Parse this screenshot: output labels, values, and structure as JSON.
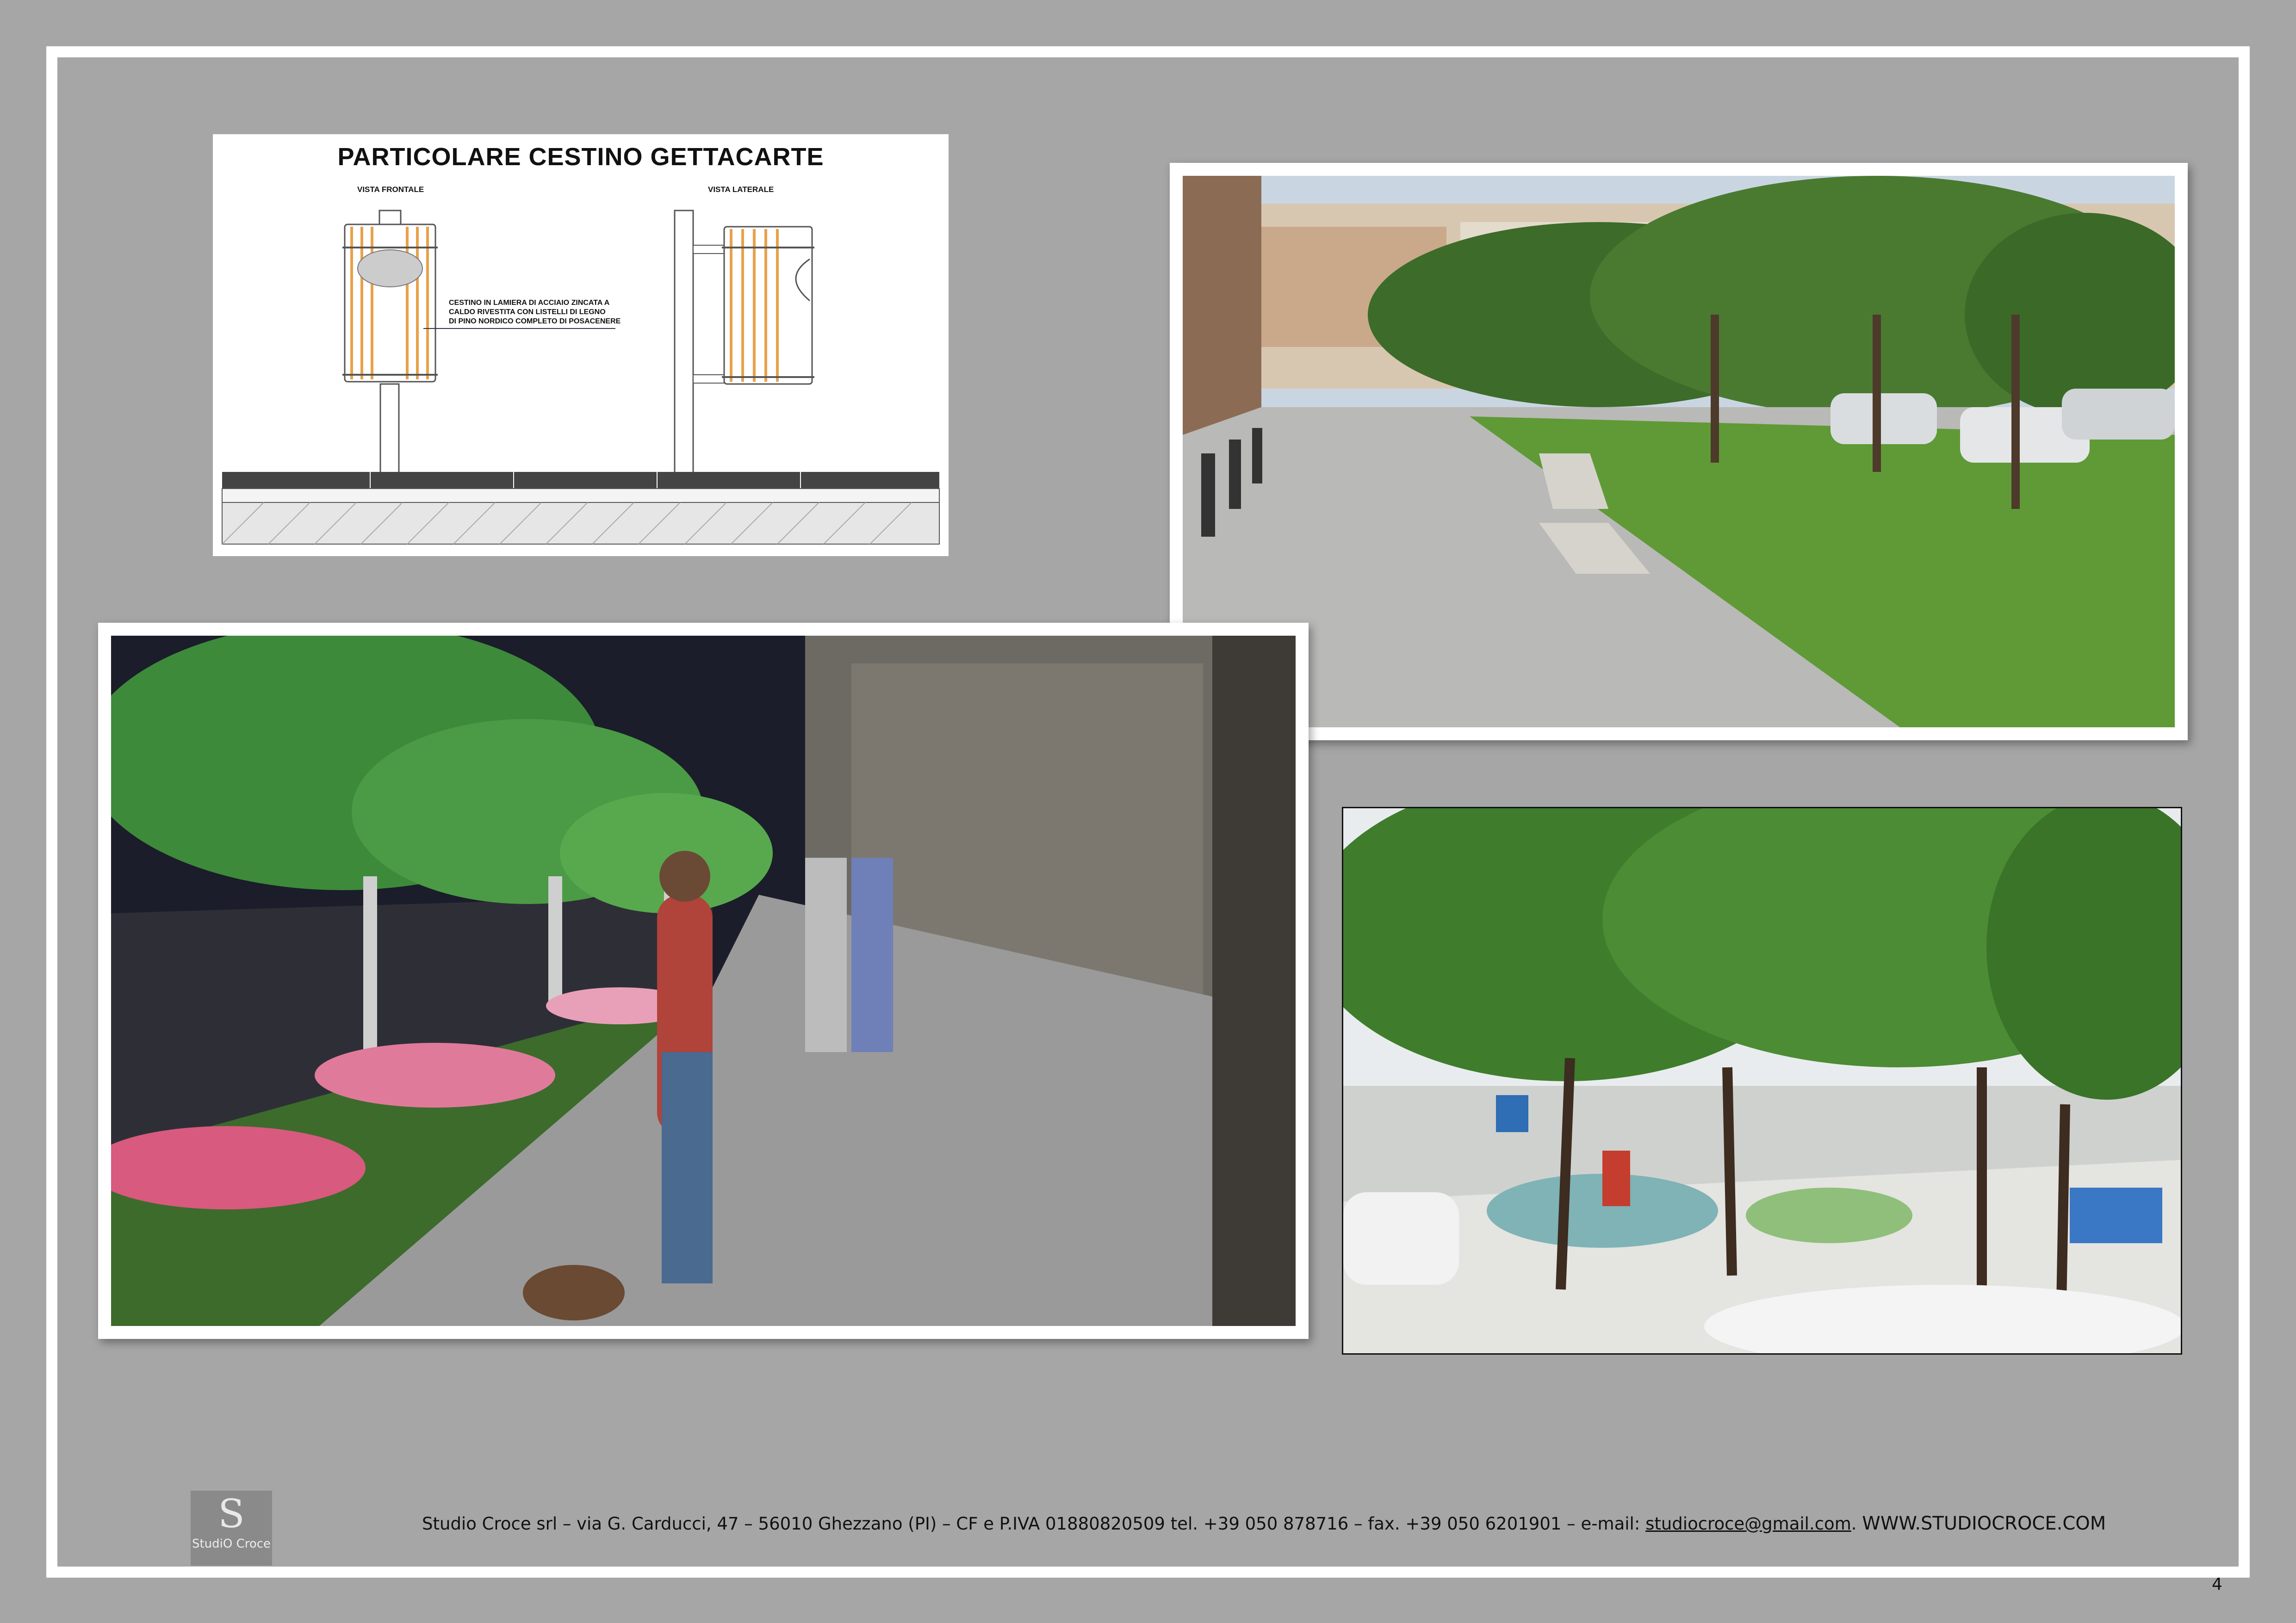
{
  "drawing": {
    "title": "PARTICOLARE CESTINO GETTACARTE",
    "view_front": "VISTA FRONTALE",
    "view_side": "VISTA LATERALE",
    "note": "CESTINO IN LAMIERA DI ACCIAIO ZINCATA A\nCALDO RIVESTITA CON LISTELLI DI LEGNO\nDI PINO NORDICO COMPLETO DI POSACENERE"
  },
  "photos": {
    "street_top": "street-photo-benches-and-lawn",
    "night_render": "night-rendering-tree-lined-promenade",
    "street_bottom": "street-photo-playground-parking"
  },
  "logo": {
    "mark": "S",
    "name": "StudiO Croce"
  },
  "footer": {
    "text_before_mail": "Studio Croce srl – via G. Carducci, 47 – 56010 Ghezzano (PI) – CF e P.IVA 01880820509 tel. +39 050 878716 – fax. +39 050 6201901 – e-mail: ",
    "email": "studiocroce@gmail.com",
    "separator": ". ",
    "website": "WWW.STUDIOCROCE.COM"
  },
  "page_number": "4",
  "colors": {
    "background": "#a6a6a6",
    "frame": "#ffffff",
    "wood": "#e8a24a",
    "grass": "#4e8a2f"
  }
}
